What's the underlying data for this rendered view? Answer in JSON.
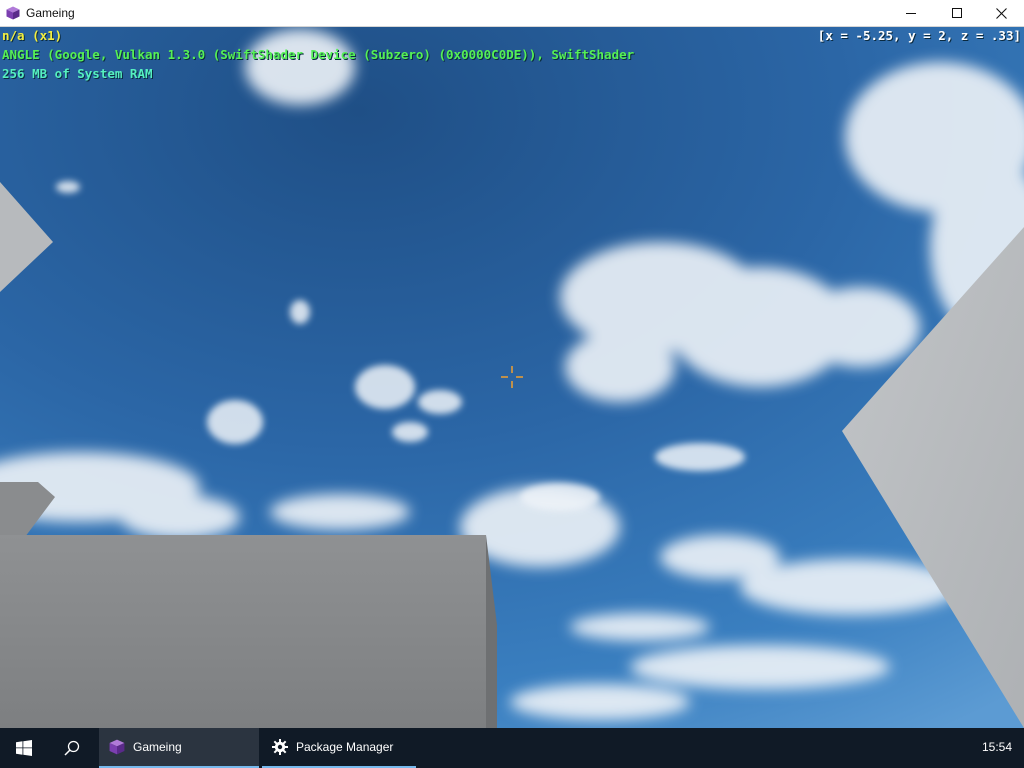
{
  "window": {
    "title": "Gameing",
    "icon": "purple-cube-icon",
    "controls": [
      "minimize-icon",
      "maximize-icon",
      "close-icon"
    ]
  },
  "hud": {
    "line1": "n/a (x1)",
    "line2": "ANGLE (Google, Vulkan 1.3.0 (SwiftShader Device (Subzero) (0x0000C0DE)), SwiftShader",
    "line3": "256 MB of System RAM",
    "coords": "[x = -5.25, y = 2, z = .33]",
    "colors": {
      "line1": "#f2ee40",
      "line2": "#55f055",
      "line3": "#55f0c0",
      "coords": "#ffffff"
    },
    "crosshair_color": "#f0a030"
  },
  "taskbar": {
    "start_icon": "windows-logo-icon",
    "search_icon": "search-icon",
    "tasks": [
      {
        "label": "Gameing",
        "icon": "purple-cube-icon",
        "state": "active"
      },
      {
        "label": "Package Manager",
        "icon": "gear-icon",
        "state": "running"
      }
    ],
    "clock": "15:54",
    "accent": "#76b9ed",
    "background": "#101a26"
  }
}
